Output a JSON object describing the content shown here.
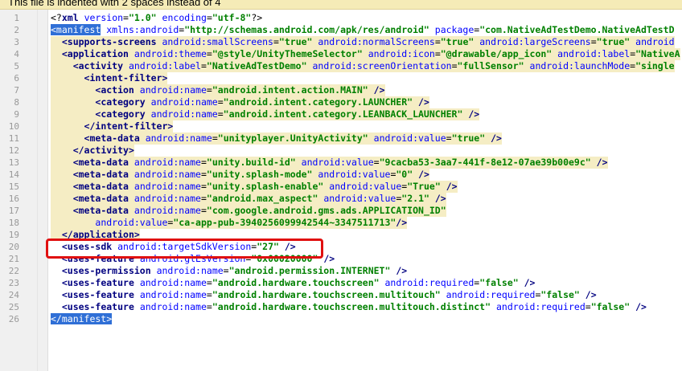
{
  "notification": {
    "text": "This file is indented with 2 spaces instead of 4"
  },
  "editor": {
    "lines": [
      {
        "num": "1",
        "parts": [
          [
            "t",
            "<?"
          ],
          [
            "n",
            "xml"
          ],
          [
            "t",
            " "
          ],
          [
            "a",
            "version"
          ],
          [
            "e",
            "="
          ],
          [
            "v",
            "\"1.0\""
          ],
          [
            "t",
            " "
          ],
          [
            "a",
            "encoding"
          ],
          [
            "e",
            "="
          ],
          [
            "v",
            "\"utf-8\""
          ],
          [
            "t",
            "?>"
          ]
        ]
      },
      {
        "num": "2",
        "parts": [
          [
            "s",
            "<manifest"
          ],
          [
            "t",
            " "
          ],
          [
            "a",
            "xmlns:android"
          ],
          [
            "e",
            "="
          ],
          [
            "v",
            "\"http://schemas.android.com/apk/res/android\""
          ],
          [
            "t",
            " "
          ],
          [
            "a",
            "package"
          ],
          [
            "e",
            "="
          ],
          [
            "v",
            "\"com.NativeAdTestDemo.NativeAdTestD"
          ]
        ]
      },
      {
        "num": "3",
        "parts": [
          [
            "t",
            "  "
          ],
          [
            "n",
            "<supports-screens"
          ],
          [
            "t",
            " "
          ],
          [
            "a",
            "android:smallScreens"
          ],
          [
            "e",
            "="
          ],
          [
            "v",
            "\"true\""
          ],
          [
            "t",
            " "
          ],
          [
            "a",
            "android:normalScreens"
          ],
          [
            "e",
            "="
          ],
          [
            "v",
            "\"true\""
          ],
          [
            "t",
            " "
          ],
          [
            "a",
            "android:largeScreens"
          ],
          [
            "e",
            "="
          ],
          [
            "v",
            "\"true\""
          ],
          [
            "t",
            " "
          ],
          [
            "a",
            "android"
          ]
        ]
      },
      {
        "num": "4",
        "parts": [
          [
            "t",
            "  "
          ],
          [
            "n",
            "<application"
          ],
          [
            "t",
            " "
          ],
          [
            "a",
            "android:theme"
          ],
          [
            "e",
            "="
          ],
          [
            "v",
            "\"@style/UnityThemeSelector\""
          ],
          [
            "t",
            " "
          ],
          [
            "a",
            "android:icon"
          ],
          [
            "e",
            "="
          ],
          [
            "v",
            "\"@drawable/app_icon\""
          ],
          [
            "t",
            " "
          ],
          [
            "a",
            "android:label"
          ],
          [
            "e",
            "="
          ],
          [
            "v",
            "\"NativeA"
          ]
        ]
      },
      {
        "num": "5",
        "parts": [
          [
            "t",
            "    "
          ],
          [
            "n",
            "<activity"
          ],
          [
            "t",
            " "
          ],
          [
            "a",
            "android:label"
          ],
          [
            "e",
            "="
          ],
          [
            "v",
            "\"NativeAdTestDemo\""
          ],
          [
            "t",
            " "
          ],
          [
            "a",
            "android:screenOrientation"
          ],
          [
            "e",
            "="
          ],
          [
            "v",
            "\"fullSensor\""
          ],
          [
            "t",
            " "
          ],
          [
            "a",
            "android:launchMode"
          ],
          [
            "e",
            "="
          ],
          [
            "v",
            "\"single"
          ]
        ]
      },
      {
        "num": "6",
        "parts": [
          [
            "t",
            "      "
          ],
          [
            "n",
            "<intent-filter"
          ],
          [
            "n",
            ">"
          ]
        ]
      },
      {
        "num": "7",
        "parts": [
          [
            "t",
            "        "
          ],
          [
            "n",
            "<action"
          ],
          [
            "t",
            " "
          ],
          [
            "a",
            "android:name"
          ],
          [
            "e",
            "="
          ],
          [
            "v",
            "\"android.intent.action.MAIN\""
          ],
          [
            "t",
            " "
          ],
          [
            "n",
            "/>"
          ]
        ]
      },
      {
        "num": "8",
        "parts": [
          [
            "t",
            "        "
          ],
          [
            "n",
            "<category"
          ],
          [
            "t",
            " "
          ],
          [
            "a",
            "android:name"
          ],
          [
            "e",
            "="
          ],
          [
            "v",
            "\"android.intent.category.LAUNCHER\""
          ],
          [
            "t",
            " "
          ],
          [
            "n",
            "/>"
          ]
        ]
      },
      {
        "num": "9",
        "parts": [
          [
            "t",
            "        "
          ],
          [
            "n",
            "<category"
          ],
          [
            "t",
            " "
          ],
          [
            "a",
            "android:name"
          ],
          [
            "e",
            "="
          ],
          [
            "v",
            "\"android.intent.category.LEANBACK_LAUNCHER\""
          ],
          [
            "t",
            " "
          ],
          [
            "n",
            "/>"
          ]
        ]
      },
      {
        "num": "10",
        "parts": [
          [
            "t",
            "      "
          ],
          [
            "n",
            "</intent-filter>"
          ]
        ]
      },
      {
        "num": "11",
        "parts": [
          [
            "t",
            "      "
          ],
          [
            "n",
            "<meta-data"
          ],
          [
            "t",
            " "
          ],
          [
            "a",
            "android:name"
          ],
          [
            "e",
            "="
          ],
          [
            "v",
            "\"unityplayer.UnityActivity\""
          ],
          [
            "t",
            " "
          ],
          [
            "a",
            "android:value"
          ],
          [
            "e",
            "="
          ],
          [
            "v",
            "\"true\""
          ],
          [
            "t",
            " "
          ],
          [
            "n",
            "/>"
          ]
        ]
      },
      {
        "num": "12",
        "parts": [
          [
            "t",
            "    "
          ],
          [
            "n",
            "</activity>"
          ]
        ]
      },
      {
        "num": "13",
        "parts": [
          [
            "t",
            "    "
          ],
          [
            "n",
            "<meta-data"
          ],
          [
            "t",
            " "
          ],
          [
            "a",
            "android:name"
          ],
          [
            "e",
            "="
          ],
          [
            "v",
            "\"unity.build-id\""
          ],
          [
            "t",
            " "
          ],
          [
            "a",
            "android:value"
          ],
          [
            "e",
            "="
          ],
          [
            "v",
            "\"9cacba53-3aa7-441f-8e12-07ae39b00e9c\""
          ],
          [
            "t",
            " "
          ],
          [
            "n",
            "/>"
          ]
        ]
      },
      {
        "num": "14",
        "parts": [
          [
            "t",
            "    "
          ],
          [
            "n",
            "<meta-data"
          ],
          [
            "t",
            " "
          ],
          [
            "a",
            "android:name"
          ],
          [
            "e",
            "="
          ],
          [
            "v",
            "\"unity.splash-mode\""
          ],
          [
            "t",
            " "
          ],
          [
            "a",
            "android:value"
          ],
          [
            "e",
            "="
          ],
          [
            "v",
            "\"0\""
          ],
          [
            "t",
            " "
          ],
          [
            "n",
            "/>"
          ]
        ]
      },
      {
        "num": "15",
        "parts": [
          [
            "t",
            "    "
          ],
          [
            "n",
            "<meta-data"
          ],
          [
            "t",
            " "
          ],
          [
            "a",
            "android:name"
          ],
          [
            "e",
            "="
          ],
          [
            "v",
            "\"unity.splash-enable\""
          ],
          [
            "t",
            " "
          ],
          [
            "a",
            "android:value"
          ],
          [
            "e",
            "="
          ],
          [
            "v",
            "\"True\""
          ],
          [
            "t",
            " "
          ],
          [
            "n",
            "/>"
          ]
        ]
      },
      {
        "num": "16",
        "parts": [
          [
            "t",
            "    "
          ],
          [
            "n",
            "<meta-data"
          ],
          [
            "t",
            " "
          ],
          [
            "a",
            "android:name"
          ],
          [
            "e",
            "="
          ],
          [
            "v",
            "\"android.max_aspect\""
          ],
          [
            "t",
            " "
          ],
          [
            "a",
            "android:value"
          ],
          [
            "e",
            "="
          ],
          [
            "v",
            "\"2.1\""
          ],
          [
            "t",
            " "
          ],
          [
            "n",
            "/>"
          ]
        ]
      },
      {
        "num": "17",
        "parts": [
          [
            "t",
            "    "
          ],
          [
            "n",
            "<meta-data"
          ],
          [
            "t",
            " "
          ],
          [
            "a",
            "android:name"
          ],
          [
            "e",
            "="
          ],
          [
            "v",
            "\"com.google.android.gms.ads.APPLICATION_ID\""
          ]
        ]
      },
      {
        "num": "18",
        "parts": [
          [
            "t",
            "        "
          ],
          [
            "a",
            "android:value"
          ],
          [
            "e",
            "="
          ],
          [
            "v",
            "\"ca-app-pub-3940256099942544~3347511713\""
          ],
          [
            "n",
            "/>"
          ]
        ]
      },
      {
        "num": "19",
        "parts": [
          [
            "t",
            "  "
          ],
          [
            "n",
            "</application>"
          ]
        ]
      },
      {
        "num": "20",
        "parts": [
          [
            "t",
            "  "
          ],
          [
            "n",
            "<uses-sdk"
          ],
          [
            "t",
            " "
          ],
          [
            "a",
            "android:targetSdkVersion"
          ],
          [
            "e",
            "="
          ],
          [
            "v",
            "\"27\""
          ],
          [
            "t",
            " "
          ],
          [
            "n",
            "/>"
          ]
        ]
      },
      {
        "num": "21",
        "parts": [
          [
            "t",
            "  "
          ],
          [
            "n",
            "<uses-feature"
          ],
          [
            "t",
            " "
          ],
          [
            "a",
            "android:glEsVersion"
          ],
          [
            "e",
            "="
          ],
          [
            "v",
            "\"0x00020000\""
          ],
          [
            "t",
            " "
          ],
          [
            "n",
            "/>"
          ]
        ]
      },
      {
        "num": "22",
        "parts": [
          [
            "t",
            "  "
          ],
          [
            "n",
            "<uses-permission"
          ],
          [
            "t",
            " "
          ],
          [
            "a",
            "android:name"
          ],
          [
            "e",
            "="
          ],
          [
            "v",
            "\"android.permission.INTERNET\""
          ],
          [
            "t",
            " "
          ],
          [
            "n",
            "/>"
          ]
        ]
      },
      {
        "num": "23",
        "parts": [
          [
            "t",
            "  "
          ],
          [
            "n",
            "<uses-feature"
          ],
          [
            "t",
            " "
          ],
          [
            "a",
            "android:name"
          ],
          [
            "e",
            "="
          ],
          [
            "v",
            "\"android.hardware.touchscreen\""
          ],
          [
            "t",
            " "
          ],
          [
            "a",
            "android:required"
          ],
          [
            "e",
            "="
          ],
          [
            "v",
            "\"false\""
          ],
          [
            "t",
            " "
          ],
          [
            "n",
            "/>"
          ]
        ]
      },
      {
        "num": "24",
        "parts": [
          [
            "t",
            "  "
          ],
          [
            "n",
            "<uses-feature"
          ],
          [
            "t",
            " "
          ],
          [
            "a",
            "android:name"
          ],
          [
            "e",
            "="
          ],
          [
            "v",
            "\"android.hardware.touchscreen.multitouch\""
          ],
          [
            "t",
            " "
          ],
          [
            "a",
            "android:required"
          ],
          [
            "e",
            "="
          ],
          [
            "v",
            "\"false\""
          ],
          [
            "t",
            " "
          ],
          [
            "n",
            "/>"
          ]
        ]
      },
      {
        "num": "25",
        "parts": [
          [
            "t",
            "  "
          ],
          [
            "n",
            "<uses-feature"
          ],
          [
            "t",
            " "
          ],
          [
            "a",
            "android:name"
          ],
          [
            "e",
            "="
          ],
          [
            "v",
            "\"android.hardware.touchscreen.multitouch.distinct\""
          ],
          [
            "t",
            " "
          ],
          [
            "a",
            "android:required"
          ],
          [
            "e",
            "="
          ],
          [
            "v",
            "\"false\""
          ],
          [
            "t",
            " "
          ],
          [
            "n",
            "/>"
          ]
        ]
      },
      {
        "num": "26",
        "parts": [
          [
            "s",
            "</manifest>"
          ]
        ]
      }
    ]
  }
}
